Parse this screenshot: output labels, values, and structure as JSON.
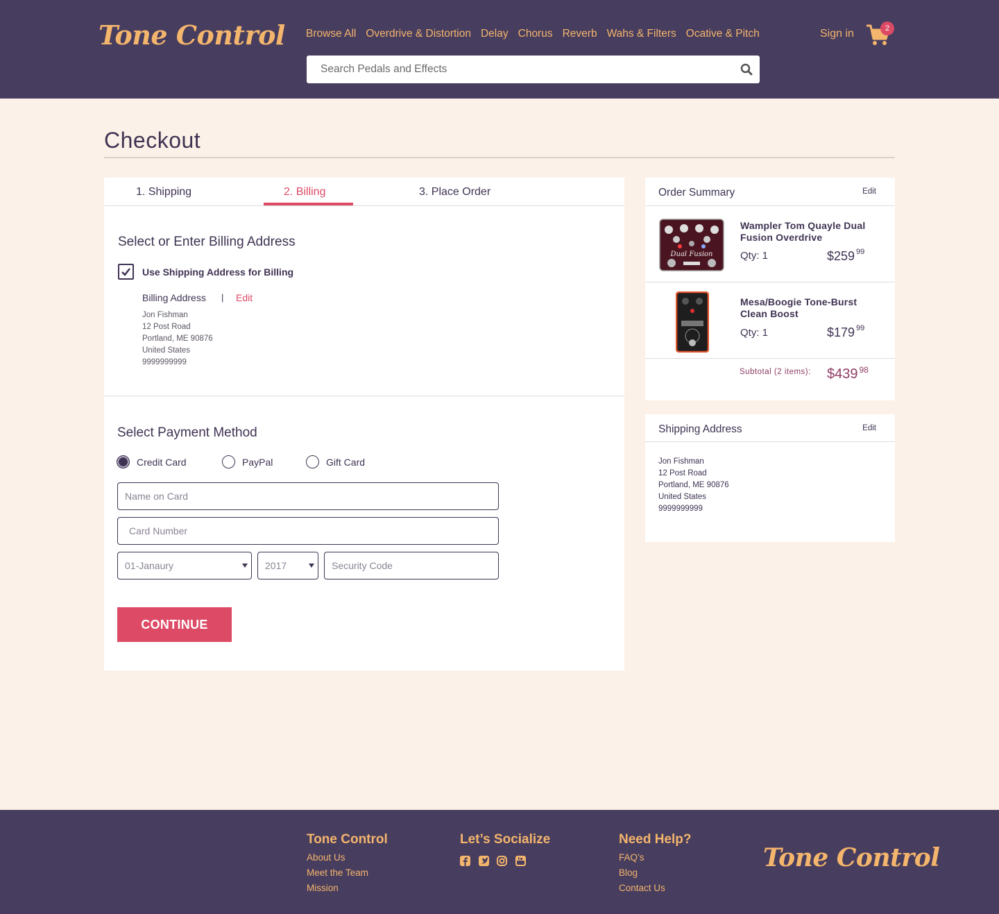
{
  "brand": {
    "name": "Tone Control"
  },
  "nav": {
    "items": [
      "Browse All",
      "Overdrive & Distortion",
      "Delay",
      "Chorus",
      "Reverb",
      "Wahs & Filters",
      "Ocative & Pitch"
    ],
    "signin": "Sign in",
    "cart_count": "2"
  },
  "search": {
    "placeholder": "Search Pedals and Effects"
  },
  "page": {
    "title": "Checkout"
  },
  "steps": {
    "shipping": "1. Shipping",
    "billing": "2. Billing",
    "place_order": "3. Place Order",
    "active": "billing"
  },
  "billing": {
    "section_title": "Select or Enter Billing Address",
    "use_shipping_label": "Use Shipping Address for Billing",
    "use_shipping_checked": true,
    "address_label": "Billing Address",
    "separator": "|",
    "edit": "Edit",
    "address": [
      "Jon Fishman",
      "12 Post Road",
      "Portland, ME 90876",
      "United States",
      "9999999999"
    ]
  },
  "payment": {
    "section_title": "Select Payment Method",
    "methods": [
      "Credit Card",
      "PayPal",
      "Gift Card"
    ],
    "selected": "Credit Card",
    "name_placeholder": "Name on Card",
    "card_placeholder": "Card Number",
    "month_value": "01-Janaury",
    "year_value": "2017",
    "cvv_placeholder": "Security Code",
    "continue": "CONTINUE"
  },
  "summary": {
    "title": "Order Summary",
    "edit": "Edit",
    "items": [
      {
        "name": "Wampler Tom Quayle Dual Fusion Overdrive",
        "qty": "Qty: 1",
        "price_main": "$259",
        "price_cents": "99"
      },
      {
        "name": "Mesa/Boogie Tone-Burst Clean Boost",
        "qty": "Qty: 1",
        "price_main": "$179",
        "price_cents": "99"
      }
    ],
    "subtotal_label": "Subtotal (2 items):",
    "subtotal_main": "$439",
    "subtotal_cents": "98"
  },
  "shipping_address": {
    "title": "Shipping Address",
    "edit": "Edit",
    "lines": [
      "Jon Fishman",
      "12 Post Road",
      "Portland, ME 90876",
      "United States",
      "9999999999"
    ]
  },
  "footer": {
    "col1": {
      "heading": "Tone Control",
      "links": [
        "About Us",
        "Meet the Team",
        "Mission"
      ]
    },
    "col2": {
      "heading": "Let’s Socialize",
      "icons": [
        "facebook-icon",
        "twitter-icon",
        "instagram-icon",
        "youtube-icon"
      ]
    },
    "col3": {
      "heading": "Need Help?",
      "links": [
        "FAQ’s",
        "Blog",
        "Contact Us"
      ]
    }
  },
  "colors": {
    "header_bg": "#473d5e",
    "accent": "#dd4a66",
    "gold": "#f4b56d",
    "page_bg": "#fcf1e8",
    "text": "#3f3352"
  }
}
